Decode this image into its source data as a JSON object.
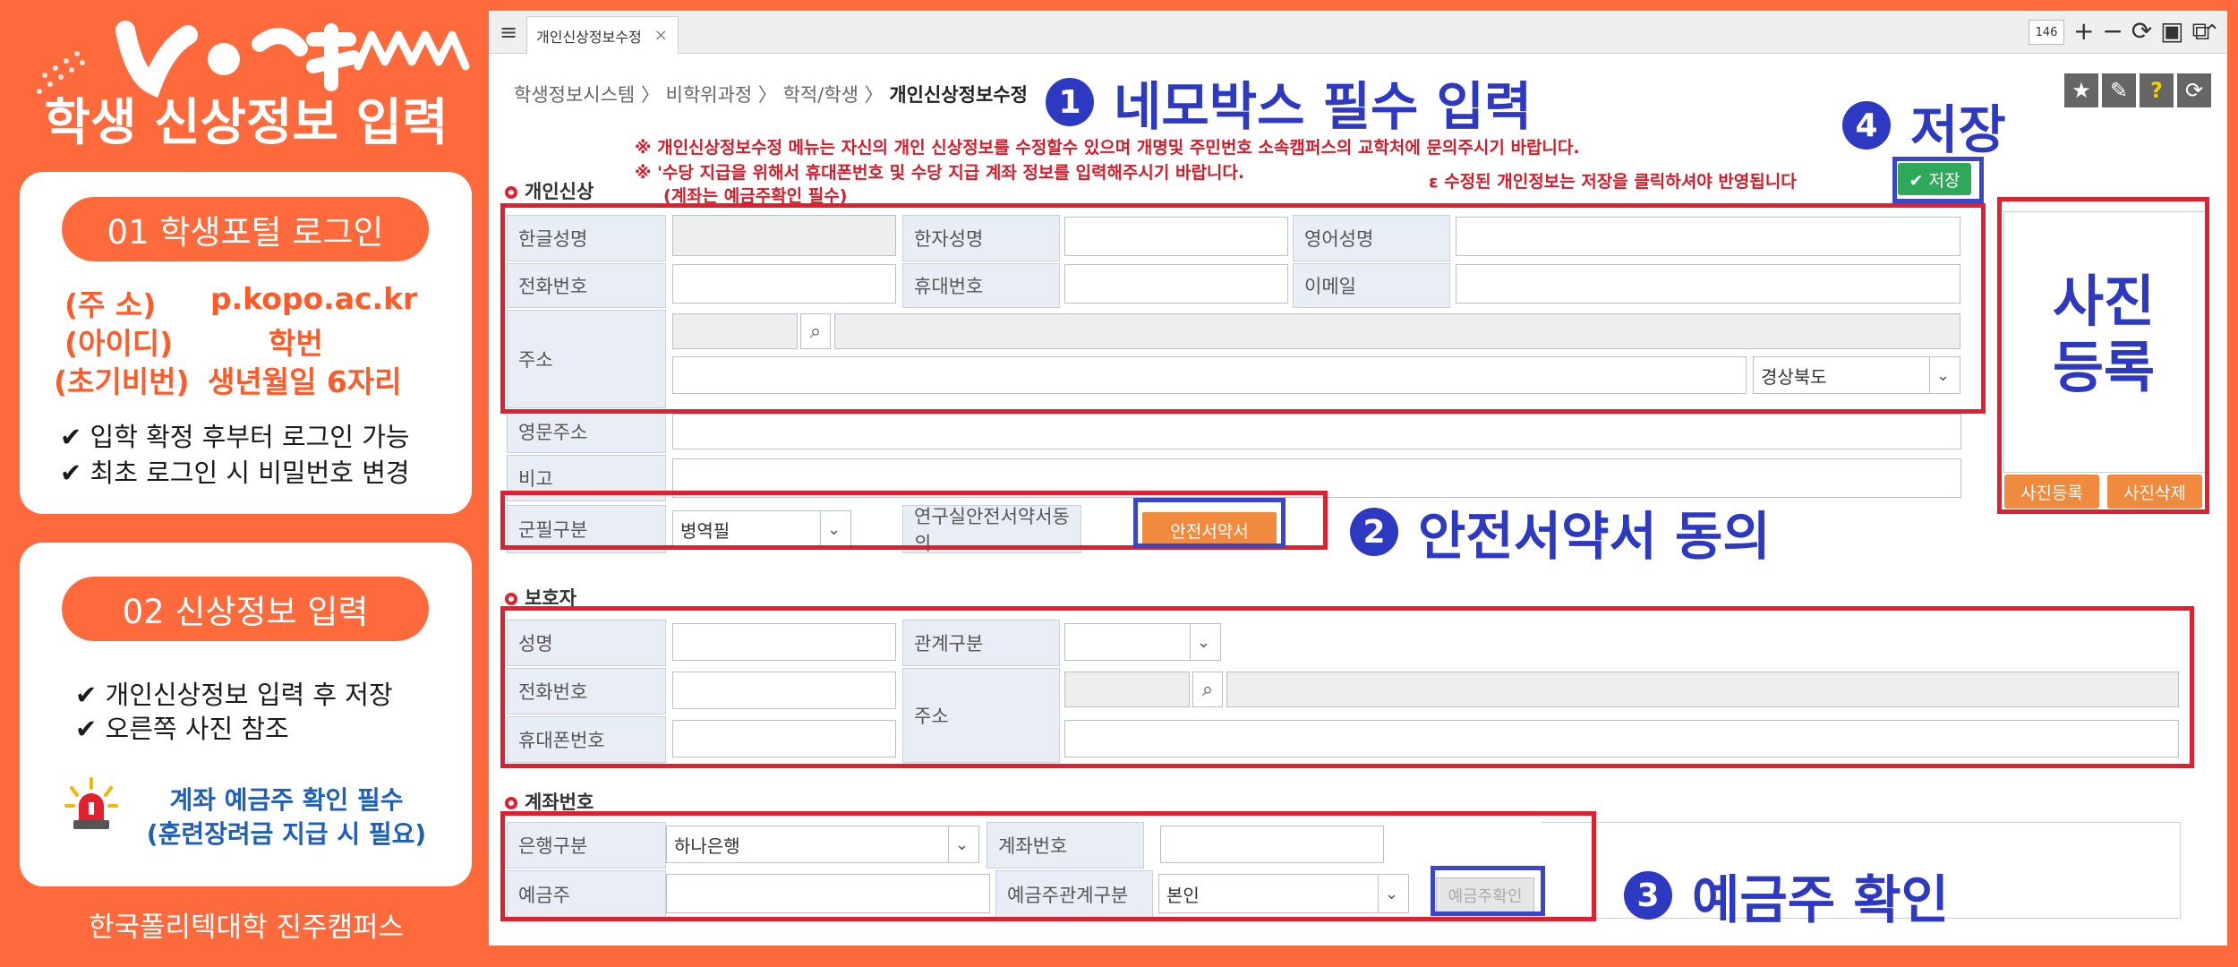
{
  "left": {
    "title": "학생 신상정보 입력",
    "card1": {
      "pill": "01 학생포털 로그인",
      "rows": [
        {
          "k": "(주    소)",
          "v": "p.kopo.ac.kr"
        },
        {
          "k": "(아이디)",
          "v": "학번"
        },
        {
          "k": "(초기비번)",
          "v": "생년월일 6자리"
        }
      ],
      "checks": [
        "✔ 입학 확정 후부터 로그인 가능",
        "✔ 최초 로그인 시 비밀번호 변경"
      ]
    },
    "card2": {
      "pill": "02 신상정보 입력",
      "checks": [
        "✔ 개인신상정보 입력 후 저장",
        "✔ 오른쪽 사진 참조"
      ],
      "alert1": "계좌 예금주 확인 필수",
      "alert2": "(훈련장려금 지급 시 필요)"
    },
    "footer": "한국폴리텍대학 진주캠퍼스"
  },
  "window": {
    "tab": "개인신상정보수정",
    "tab_close": "×",
    "zoom": "146",
    "breadcrumb": [
      "학생정보시스템",
      "비학위과정",
      "학적/학생"
    ],
    "breadcrumb_current": "개인신상정보수정",
    "notice1": "※ 개인신상정보수정 메뉴는 자신의 개인 신상정보를 수정할수 있으며 개명및 주민번호 소속캠퍼스의 교학처에 문의주시기 바랍니다.",
    "notice2": "※ '수당 지급을 위해서 휴대폰번호 및 수당 지급 계좌 정보를 입력해주시기 바랍니다.",
    "notice3": "(계좌는 예금주확인 필수)",
    "notice4": "ε 수정된 개인정보는 저장을 클릭하셔야 반영됩니다",
    "save": "✔ 저장",
    "sections": {
      "personal": "개인신상",
      "guardian": "보호자",
      "account": "계좌번호"
    },
    "personal": {
      "korean_name": "한글성명",
      "hanja_name": "한자성명",
      "english_name": "영어성명",
      "phone": "전화번호",
      "mobile": "휴대번호",
      "email": "이메일",
      "address": "주소",
      "region": "경상북도",
      "english_address": "영문주소",
      "note": "비고",
      "military": "군필구분",
      "military_value": "병역필",
      "lab_safety": "연구실안전서약서동의",
      "safety_btn": "안전서약서"
    },
    "photo": {
      "register": "사진등록",
      "delete": "사진삭제"
    },
    "guardian": {
      "name": "성명",
      "relation": "관계구분",
      "phone": "전화번호",
      "address": "주소",
      "mobile": "휴대폰번호"
    },
    "account": {
      "bank": "은행구분",
      "bank_value": "하나은행",
      "number": "계좌번호",
      "holder": "예금주",
      "holder_relation": "예금주관계구분",
      "holder_relation_value": "본인",
      "verify": "예금주확인"
    }
  },
  "annotations": {
    "a1": "네모박스 필수 입력",
    "a2": "안전서약서 동의",
    "a3": "예금주 확인",
    "a4": "저장",
    "photo1": "사진",
    "photo2": "등록",
    "n1": "1",
    "n2": "2",
    "n3": "3",
    "n4": "4"
  }
}
